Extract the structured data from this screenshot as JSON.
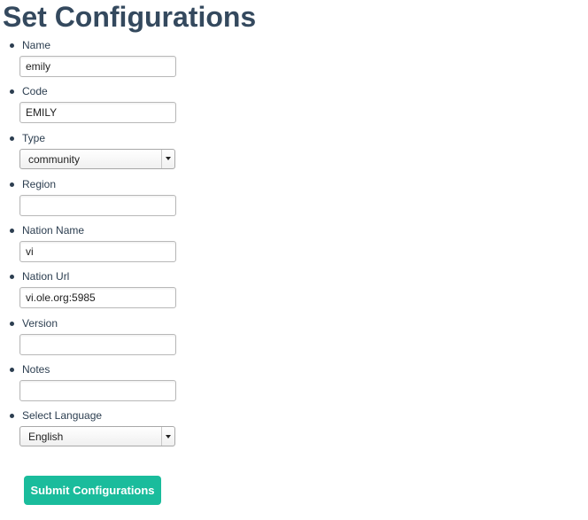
{
  "page": {
    "title": "Set Configurations"
  },
  "form": {
    "fields": [
      {
        "label": "Name",
        "type": "text",
        "value": "emily",
        "placeholder": ""
      },
      {
        "label": "Code",
        "type": "text",
        "value": "EMILY",
        "placeholder": ""
      },
      {
        "label": "Type",
        "type": "select",
        "value": "community"
      },
      {
        "label": "Region",
        "type": "text",
        "value": "",
        "placeholder": ""
      },
      {
        "label": "Nation Name",
        "type": "text",
        "value": "vi",
        "placeholder": ""
      },
      {
        "label": "Nation Url",
        "type": "text",
        "value": "vi.ole.org:5985",
        "placeholder": ""
      },
      {
        "label": "Version",
        "type": "text",
        "value": "",
        "placeholder": ""
      },
      {
        "label": "Notes",
        "type": "text",
        "value": "",
        "placeholder": ""
      },
      {
        "label": "Select Language",
        "type": "select",
        "value": "English"
      }
    ],
    "submit_label": "Submit Configurations"
  },
  "colors": {
    "title": "#34495e",
    "text": "#2c3e50",
    "accent": "#1abc9c"
  },
  "icons": {
    "select_arrow": "chevron-down-icon",
    "bullet": "bullet-dot"
  }
}
